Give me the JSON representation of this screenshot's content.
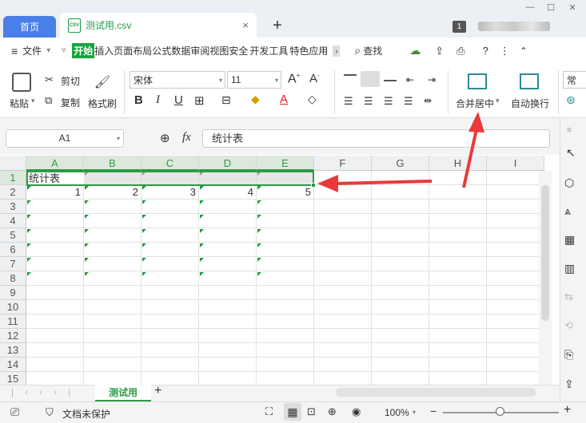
{
  "titlebar": {
    "home_tab": "首页",
    "doc_tab": "测试用.csv",
    "file_icon_text": "CSV",
    "close": "×",
    "new_tab": "+",
    "badge": "1"
  },
  "menubar": {
    "file": "文件",
    "items": [
      "开始",
      "插入",
      "页面布局",
      "公式",
      "数据",
      "审阅",
      "视图",
      "安全",
      "开发工具",
      "特色应用"
    ],
    "active": "开始",
    "search": "查找"
  },
  "ribbon": {
    "paste": "粘贴",
    "cut": "剪切",
    "copy": "复制",
    "format_painter": "格式刷",
    "font_name": "宋体",
    "font_size": "11",
    "merge_center": "合并居中",
    "wrap_text": "自动换行",
    "partial": "常"
  },
  "formula_bar": {
    "cell_ref": "A1",
    "fx": "fx",
    "value": "统计表"
  },
  "sheet": {
    "columns": [
      "A",
      "B",
      "C",
      "D",
      "E",
      "F",
      "G",
      "H",
      "I"
    ],
    "selected_columns": [
      "A",
      "B",
      "C",
      "D",
      "E"
    ],
    "rows": [
      "1",
      "2",
      "3",
      "4",
      "5",
      "6",
      "7",
      "8",
      "9",
      "10",
      "11",
      "12",
      "13",
      "14",
      "15"
    ],
    "a1": "统计表",
    "row2_values": [
      "1",
      "2",
      "3",
      "4",
      "5"
    ],
    "tab": "测试用",
    "add_sheet": "+"
  },
  "statusbar": {
    "protect": "文档未保护",
    "zoom": "100%",
    "minus": "−",
    "plus": "+"
  },
  "colors": {
    "accent_green": "#2d9b47",
    "home_tab_blue": "#4a7ee8",
    "arrow_red": "#e83a3a"
  }
}
